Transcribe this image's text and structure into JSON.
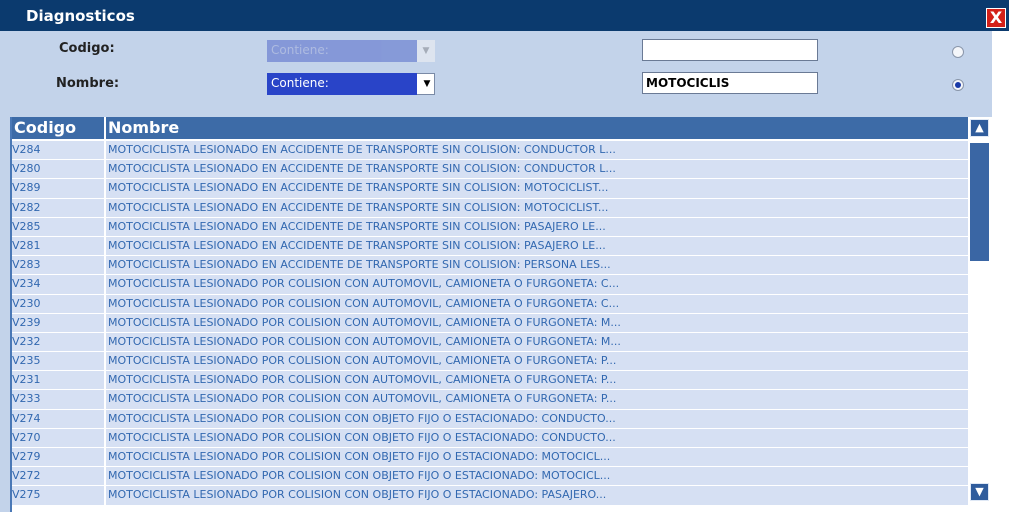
{
  "window": {
    "title": "Diagnosticos",
    "close_label": "X"
  },
  "filters": {
    "codigo": {
      "label": "Codigo:",
      "operator": "Contiene:",
      "value": "",
      "selected": false
    },
    "nombre": {
      "label": "Nombre:",
      "operator": "Contiene:",
      "value": "MOTOCICLIS",
      "selected": true
    }
  },
  "grid": {
    "columns": [
      "Codigo",
      "Nombre"
    ],
    "rows": [
      {
        "code": "V284",
        "name": "MOTOCICLISTA LESIONADO EN ACCIDENTE DE TRANSPORTE SIN COLISION: CONDUCTOR L..."
      },
      {
        "code": "V280",
        "name": "MOTOCICLISTA LESIONADO EN ACCIDENTE DE TRANSPORTE SIN COLISION: CONDUCTOR L..."
      },
      {
        "code": "V289",
        "name": "MOTOCICLISTA LESIONADO EN ACCIDENTE DE TRANSPORTE SIN COLISION: MOTOCICLIST..."
      },
      {
        "code": "V282",
        "name": "MOTOCICLISTA LESIONADO EN ACCIDENTE DE TRANSPORTE SIN COLISION: MOTOCICLIST..."
      },
      {
        "code": "V285",
        "name": "MOTOCICLISTA LESIONADO EN ACCIDENTE DE TRANSPORTE SIN COLISION: PASAJERO LE..."
      },
      {
        "code": "V281",
        "name": "MOTOCICLISTA LESIONADO EN ACCIDENTE DE TRANSPORTE SIN COLISION: PASAJERO LE..."
      },
      {
        "code": "V283",
        "name": "MOTOCICLISTA LESIONADO EN ACCIDENTE DE TRANSPORTE SIN COLISION: PERSONA LES..."
      },
      {
        "code": "V234",
        "name": "MOTOCICLISTA LESIONADO POR COLISION CON AUTOMOVIL, CAMIONETA O FURGONETA: C..."
      },
      {
        "code": "V230",
        "name": "MOTOCICLISTA LESIONADO POR COLISION CON AUTOMOVIL, CAMIONETA O FURGONETA: C..."
      },
      {
        "code": "V239",
        "name": "MOTOCICLISTA LESIONADO POR COLISION CON AUTOMOVIL, CAMIONETA O FURGONETA: M..."
      },
      {
        "code": "V232",
        "name": "MOTOCICLISTA LESIONADO POR COLISION CON AUTOMOVIL, CAMIONETA O FURGONETA: M..."
      },
      {
        "code": "V235",
        "name": "MOTOCICLISTA LESIONADO POR COLISION CON AUTOMOVIL, CAMIONETA O FURGONETA: P..."
      },
      {
        "code": "V231",
        "name": "MOTOCICLISTA LESIONADO POR COLISION CON AUTOMOVIL, CAMIONETA O FURGONETA: P..."
      },
      {
        "code": "V233",
        "name": "MOTOCICLISTA LESIONADO POR COLISION CON AUTOMOVIL, CAMIONETA O FURGONETA: P..."
      },
      {
        "code": "V274",
        "name": "MOTOCICLISTA LESIONADO POR COLISION CON OBJETO FIJO O ESTACIONADO: CONDUCTO..."
      },
      {
        "code": "V270",
        "name": "MOTOCICLISTA LESIONADO POR COLISION CON OBJETO FIJO O ESTACIONADO: CONDUCTO..."
      },
      {
        "code": "V279",
        "name": "MOTOCICLISTA LESIONADO POR COLISION CON OBJETO FIJO O ESTACIONADO: MOTOCICL..."
      },
      {
        "code": "V272",
        "name": "MOTOCICLISTA LESIONADO POR COLISION CON OBJETO FIJO O ESTACIONADO: MOTOCICL..."
      },
      {
        "code": "V275",
        "name": "MOTOCICLISTA LESIONADO POR COLISION CON OBJETO FIJO O ESTACIONADO: PASAJERO..."
      }
    ]
  },
  "scrollbar": {
    "up_icon": "arrow-up-icon",
    "down_icon": "arrow-down-icon"
  },
  "colors": {
    "titlebar": "#0b3a6e",
    "panel": "#c3d3ea",
    "header": "#3d6ba7",
    "row": "#d6e0f3",
    "row_text": "#3268b0",
    "close": "#d32018"
  }
}
